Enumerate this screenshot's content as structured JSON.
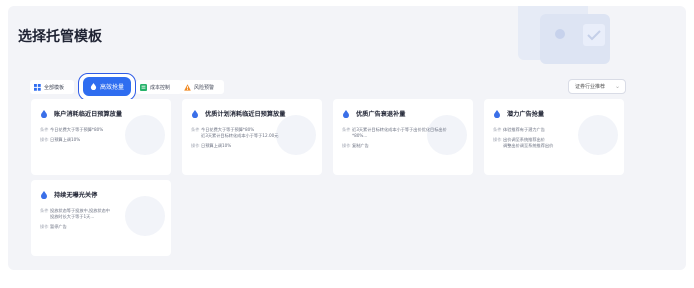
{
  "page": {
    "title": "选择托管模板"
  },
  "tabs": {
    "all": "全部模板",
    "active": "高效抢量",
    "cost": "成本控制",
    "risk": "风险预警"
  },
  "industry_select": {
    "value": "证券行业推荐"
  },
  "colors": {
    "accent": "#2f6df0",
    "outline": "#2e5be6"
  },
  "cards": [
    {
      "title": "账户消耗临近日预算放量",
      "cond_label": "条件",
      "cond": [
        "今日花费大于等于预算*80%"
      ],
      "op_label": "操作",
      "op": [
        "日预算上调10%"
      ]
    },
    {
      "title": "优质计划消耗临近日预算放量",
      "cond_label": "条件",
      "cond": [
        "今日花费大于等于预算*80%",
        "近3天累计目标转化成本小于等于12.00元"
      ],
      "op_label": "操作",
      "op": [
        "日预算上调10%"
      ]
    },
    {
      "title": "优质广告衰退补量",
      "cond_label": "条件",
      "cond": [
        "近3天累计目标转化成本小于等于出价优化目标出价",
        "*80%..."
      ],
      "op_label": "操作",
      "op": [
        "复制广告"
      ]
    },
    {
      "title": "潜力广告抢量",
      "cond_label": "条件",
      "cond": [
        "体验推荐有于潜力广告"
      ],
      "op_label": "操作",
      "op": [
        "出价调至系统推荐出价",
        "调整出价调至系统推荐出价"
      ]
    },
    {
      "title": "持续无曝光关停",
      "cond_label": "条件",
      "cond": [
        "投放状态等于投放中,投放状态中",
        "投放时长大于等于1天..."
      ],
      "op_label": "操作",
      "op": [
        "暂停广告"
      ]
    }
  ]
}
